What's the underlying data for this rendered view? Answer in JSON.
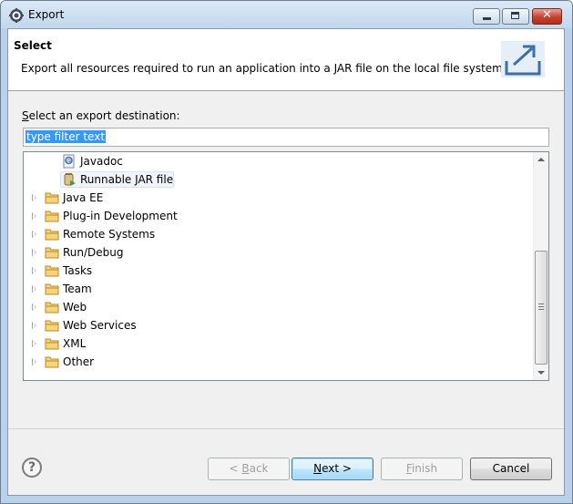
{
  "window": {
    "title": "Export",
    "icon": "eclipse-gear-icon"
  },
  "header": {
    "title": "Select",
    "description": "Export all resources required to run an application into a JAR file on the local file system."
  },
  "destination": {
    "label_mnemonic": "S",
    "label_rest": "elect an export destination:",
    "filter_text": "type filter text"
  },
  "tree": {
    "leaf_items": [
      {
        "label": "Javadoc",
        "icon": "javadoc-icon"
      },
      {
        "label": "Runnable JAR file",
        "icon": "jar-icon",
        "selected": true
      }
    ],
    "folders": [
      {
        "label": "Java EE"
      },
      {
        "label": "Plug-in Development"
      },
      {
        "label": "Remote Systems"
      },
      {
        "label": "Run/Debug"
      },
      {
        "label": "Tasks"
      },
      {
        "label": "Team"
      },
      {
        "label": "Web"
      },
      {
        "label": "Web Services"
      },
      {
        "label": "XML"
      },
      {
        "label": "Other"
      }
    ]
  },
  "buttons": {
    "help": "?",
    "back_mnemonic": "B",
    "back_prefix": "< ",
    "back_rest": "ack",
    "next_mnemonic": "N",
    "next_rest": "ext >",
    "finish_mnemonic": "F",
    "finish_rest": "inish",
    "cancel": "Cancel"
  },
  "colors": {
    "selection": "#3399ff",
    "title_bar": "#c2d8ee",
    "folder": "#e8b84a"
  }
}
